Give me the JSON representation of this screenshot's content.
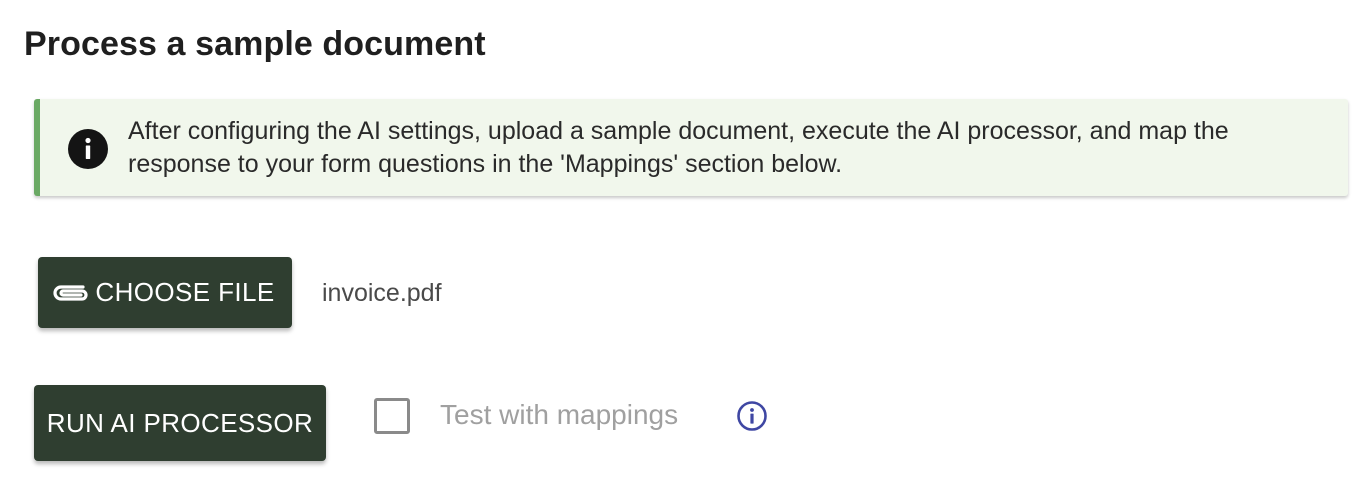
{
  "page": {
    "title": "Process a sample document"
  },
  "alert": {
    "icon": "info-icon",
    "message": "After configuring the AI settings, upload a sample document, execute the AI processor, and map the response to your form questions in the 'Mappings' section below.",
    "accent_color": "#6aa964",
    "background_color": "#f1f7ec"
  },
  "upload": {
    "button_label": "CHOOSE FILE",
    "button_icon": "paperclip-icon",
    "file_name": "invoice.pdf"
  },
  "processor": {
    "run_label": "RUN AI PROCESSOR",
    "test_with_mappings": {
      "label": "Test with mappings",
      "checked": false,
      "help_icon": "info-outline-icon"
    }
  },
  "colors": {
    "button_bg": "#2f3e30",
    "help_icon": "#3f47a3"
  }
}
